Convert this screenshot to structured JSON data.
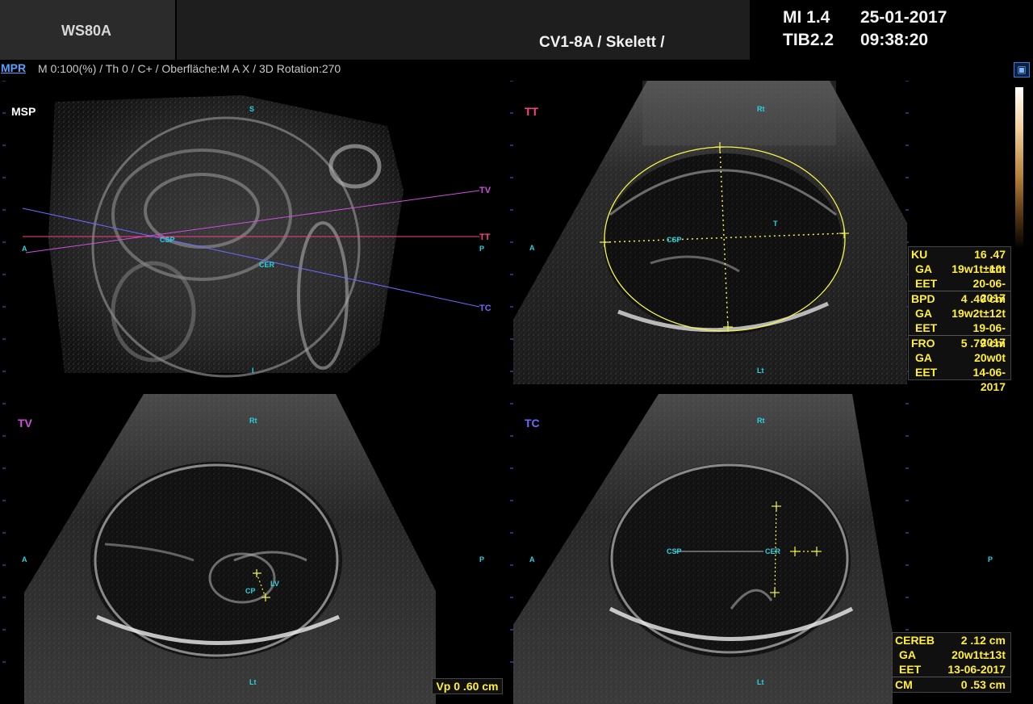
{
  "header": {
    "model": "WS80A",
    "probe_preset": "CV1-8A / Skelett /",
    "mi": "MI  1.4",
    "tib": "TIB2.2",
    "date": "25-01-2017",
    "time": "09:38:20"
  },
  "status_bar": {
    "mode": "MPR",
    "params": "M 0:100(%) / Th 0 / C+ / Oberfläche:M A X / 3D Rotation:270"
  },
  "quadrants": {
    "msp": {
      "label": "MSP",
      "label_color": "#ffffff",
      "top": "S",
      "bottom": "I",
      "left": "A",
      "right": "P",
      "lines": [
        {
          "name": "TV",
          "color": "#d24ee0"
        },
        {
          "name": "TT",
          "color": "#ff3f8a"
        },
        {
          "name": "TC",
          "color": "#6b6bff"
        }
      ],
      "markers": [
        "CSP",
        "CER"
      ]
    },
    "tt": {
      "label": "TT",
      "label_color": "#ff3f8a",
      "top": "Rt",
      "bottom": "Lt",
      "left": "A",
      "markers": [
        "CSP",
        "T"
      ]
    },
    "tv": {
      "label": "TV",
      "label_color": "#d24ee0",
      "top": "Rt",
      "bottom": "Lt",
      "left": "A",
      "right": "P",
      "markers": [
        "CP",
        "LV"
      ]
    },
    "tc": {
      "label": "TC",
      "label_color": "#6b6bff",
      "top": "Rt",
      "bottom": "Lt",
      "left": "A",
      "right": "P",
      "markers": [
        "CSP",
        "CER"
      ]
    }
  },
  "measurements_tt": [
    {
      "key": "KU",
      "value": "16 .47 cm"
    },
    {
      "key": "GA",
      "value": "19w1t±10t"
    },
    {
      "key": "EET",
      "value": "20-06-2017"
    },
    {
      "key": "BPD",
      "value": "4 .40 cm"
    },
    {
      "key": "GA",
      "value": "19w2t±12t"
    },
    {
      "key": "EET",
      "value": "19-06-2017"
    },
    {
      "key": "FRO",
      "value": "5 .79 cm"
    },
    {
      "key": "GA",
      "value": "20w0t"
    },
    {
      "key": "EET",
      "value": "14-06-2017"
    }
  ],
  "measurements_tc": [
    {
      "key": "CEREB",
      "value": "2 .12 cm"
    },
    {
      "key": "GA",
      "value": "20w1t±13t"
    },
    {
      "key": "EET",
      "value": "13-06-2017"
    },
    {
      "key": "CM",
      "value": "0 .53 cm"
    }
  ],
  "vp": "Vp 0 .60 cm",
  "colors": {
    "caliper": "#ffef3a",
    "orientation": "#29d3e0",
    "accent_link": "#5aa0ff"
  }
}
